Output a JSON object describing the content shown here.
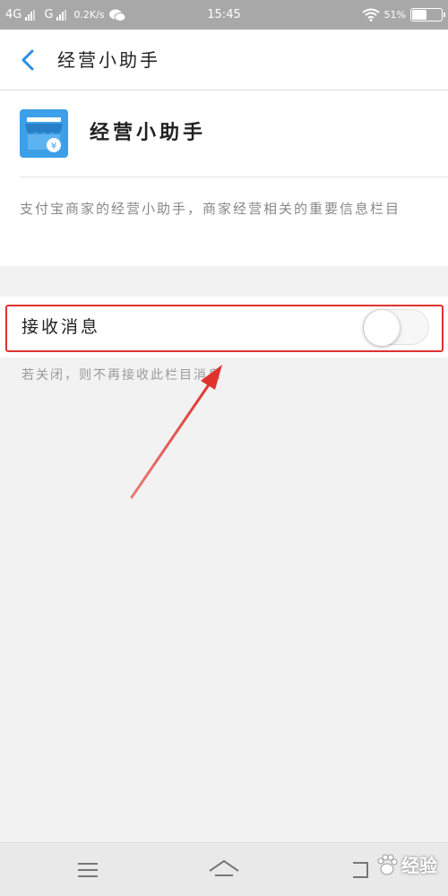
{
  "status_bar": {
    "network_1": "4G",
    "network_2": "G",
    "speed": "0.2K/s",
    "time": "15:45",
    "battery": "51%",
    "battery_level": 0.51,
    "icons": [
      "signal-icon",
      "wechat-icon",
      "wifi-icon",
      "battery-icon"
    ]
  },
  "header": {
    "title": "经营小助手",
    "back_icon": "chevron-left-icon",
    "accent": "#2a8ee0"
  },
  "app_info": {
    "name": "经营小助手",
    "icon": "store-icon",
    "icon_color": "#3d9fe8",
    "description": "支付宝商家的经营小助手，商家经营相关的重要信息栏目"
  },
  "settings": {
    "receive_label": "接收消息",
    "receive_enabled": false,
    "hint": "若关闭，则不再接收此栏目消息"
  },
  "annotation": {
    "highlight_color": "#e0322d"
  },
  "nav_bar": {
    "icons": [
      "menu-icon",
      "home-icon",
      "back-icon"
    ]
  },
  "watermark": {
    "text": "经验"
  }
}
